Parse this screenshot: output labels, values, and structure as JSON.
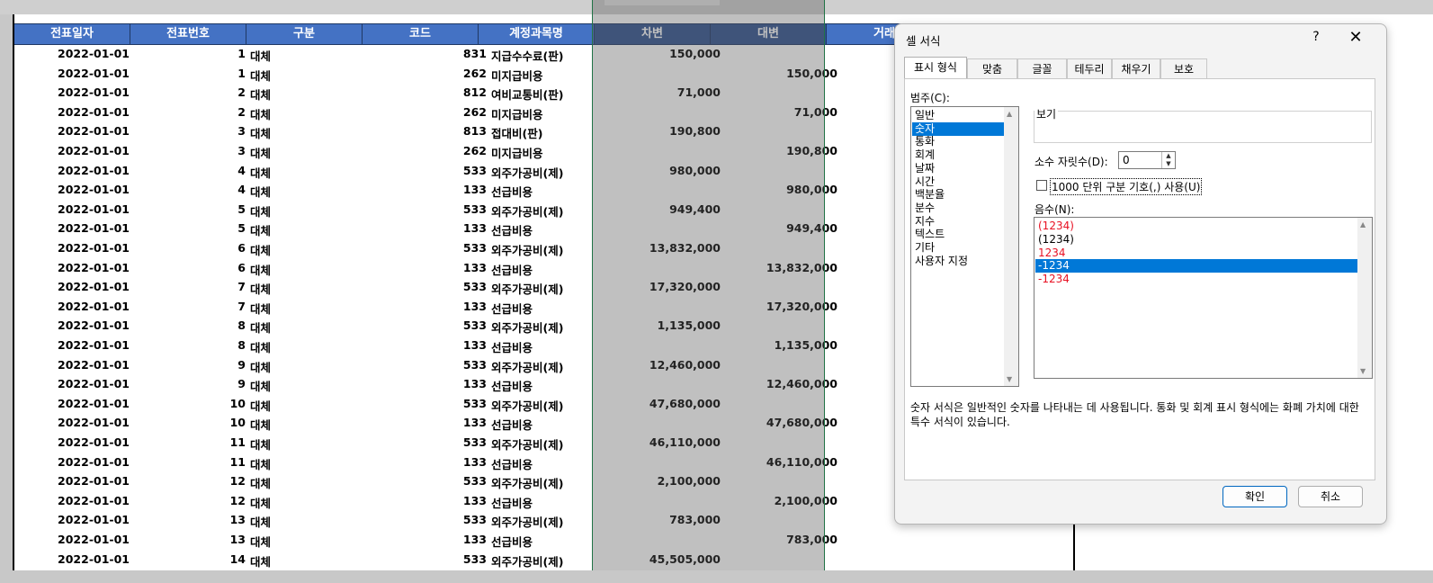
{
  "columns": [
    "전표일자",
    "전표번호",
    "구분",
    "코드",
    "계정과목명",
    "차변",
    "대변",
    "거래"
  ],
  "rows": [
    [
      "2022-01-01",
      "1",
      "대체",
      "831",
      "지급수수료(판)",
      "150,000",
      ""
    ],
    [
      "2022-01-01",
      "1",
      "대체",
      "262",
      "미지급비용",
      "",
      "150,000"
    ],
    [
      "2022-01-01",
      "2",
      "대체",
      "812",
      "여비교통비(판)",
      "71,000",
      ""
    ],
    [
      "2022-01-01",
      "2",
      "대체",
      "262",
      "미지급비용",
      "",
      "71,000"
    ],
    [
      "2022-01-01",
      "3",
      "대체",
      "813",
      "접대비(판)",
      "190,800",
      ""
    ],
    [
      "2022-01-01",
      "3",
      "대체",
      "262",
      "미지급비용",
      "",
      "190,800"
    ],
    [
      "2022-01-01",
      "4",
      "대체",
      "533",
      "외주가공비(제)",
      "980,000",
      ""
    ],
    [
      "2022-01-01",
      "4",
      "대체",
      "133",
      "선급비용",
      "",
      "980,000"
    ],
    [
      "2022-01-01",
      "5",
      "대체",
      "533",
      "외주가공비(제)",
      "949,400",
      ""
    ],
    [
      "2022-01-01",
      "5",
      "대체",
      "133",
      "선급비용",
      "",
      "949,400"
    ],
    [
      "2022-01-01",
      "6",
      "대체",
      "533",
      "외주가공비(제)",
      "13,832,000",
      ""
    ],
    [
      "2022-01-01",
      "6",
      "대체",
      "133",
      "선급비용",
      "",
      "13,832,000"
    ],
    [
      "2022-01-01",
      "7",
      "대체",
      "533",
      "외주가공비(제)",
      "17,320,000",
      ""
    ],
    [
      "2022-01-01",
      "7",
      "대체",
      "133",
      "선급비용",
      "",
      "17,320,000"
    ],
    [
      "2022-01-01",
      "8",
      "대체",
      "533",
      "외주가공비(제)",
      "1,135,000",
      ""
    ],
    [
      "2022-01-01",
      "8",
      "대체",
      "133",
      "선급비용",
      "",
      "1,135,000"
    ],
    [
      "2022-01-01",
      "9",
      "대체",
      "533",
      "외주가공비(제)",
      "12,460,000",
      ""
    ],
    [
      "2022-01-01",
      "9",
      "대체",
      "133",
      "선급비용",
      "",
      "12,460,000"
    ],
    [
      "2022-01-01",
      "10",
      "대체",
      "533",
      "외주가공비(제)",
      "47,680,000",
      ""
    ],
    [
      "2022-01-01",
      "10",
      "대체",
      "133",
      "선급비용",
      "",
      "47,680,000"
    ],
    [
      "2022-01-01",
      "11",
      "대체",
      "533",
      "외주가공비(제)",
      "46,110,000",
      ""
    ],
    [
      "2022-01-01",
      "11",
      "대체",
      "133",
      "선급비용",
      "",
      "46,110,000"
    ],
    [
      "2022-01-01",
      "12",
      "대체",
      "533",
      "외주가공비(제)",
      "2,100,000",
      ""
    ],
    [
      "2022-01-01",
      "12",
      "대체",
      "133",
      "선급비용",
      "",
      "2,100,000"
    ],
    [
      "2022-01-01",
      "13",
      "대체",
      "533",
      "외주가공비(제)",
      "783,000",
      ""
    ],
    [
      "2022-01-01",
      "13",
      "대체",
      "133",
      "선급비용",
      "",
      "783,000"
    ],
    [
      "2022-01-01",
      "14",
      "대체",
      "533",
      "외주가공비(제)",
      "45,505,000",
      ""
    ]
  ],
  "dialog": {
    "title": "셀 서식",
    "help": "?",
    "close": "✕",
    "tabs": [
      "표시 형식",
      "맞춤",
      "글꼴",
      "테두리",
      "채우기",
      "보호"
    ],
    "category_label": "범주(C):",
    "categories": [
      "일반",
      "숫자",
      "통화",
      "회계",
      "날짜",
      "시간",
      "백분율",
      "분수",
      "지수",
      "텍스트",
      "기타",
      "사용자 지정"
    ],
    "selected_category": "숫자",
    "sample_label": "보기",
    "decimal_label": "소수 자릿수(D):",
    "decimal_value": "0",
    "thousands_label": "1000 단위 구분 기호(,) 사용(U)",
    "negative_label": "음수(N):",
    "negative_options": [
      {
        "text": "(1234)",
        "red": true
      },
      {
        "text": "(1234)",
        "red": false
      },
      {
        "text": "1234",
        "red": true
      },
      {
        "text": "-1234",
        "red": false,
        "selected": true
      },
      {
        "text": "-1234",
        "red": true
      }
    ],
    "description": "숫자 서식은 일반적인 숫자를 나타내는 데 사용됩니다. 통화 및 회계 표시 형식에는 화폐 가치에 대한 특수 서식이 있습니다.",
    "ok": "확인",
    "cancel": "취소"
  },
  "colors": {
    "header_bg": "#4472c4",
    "header_selected_bg": "#2f528f",
    "selection_border": "#217346",
    "list_selected": "#0078d7",
    "negative_red": "#e81123"
  }
}
